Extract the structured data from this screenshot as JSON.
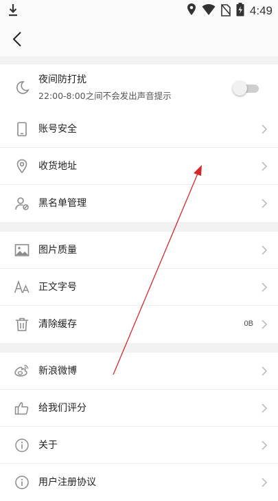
{
  "status_bar": {
    "time": "4:49"
  },
  "sections": {
    "night": {
      "title": "夜间防打扰",
      "subtitle": "22:00-8:00之间不会发出声音提示",
      "toggle_on": false
    },
    "account": [
      {
        "label": "账号安全",
        "icon": "phone-icon"
      },
      {
        "label": "收货地址",
        "icon": "location-pin-icon"
      },
      {
        "label": "黑名单管理",
        "icon": "user-block-icon"
      }
    ],
    "display": [
      {
        "label": "图片质量",
        "icon": "image-icon"
      },
      {
        "label": "正文字号",
        "icon": "font-size-icon"
      },
      {
        "label": "清除缓存",
        "icon": "trash-icon",
        "value": "0B"
      }
    ],
    "about": [
      {
        "label": "新浪微博",
        "icon": "weibo-icon"
      },
      {
        "label": "给我们评分",
        "icon": "thumbs-up-icon"
      },
      {
        "label": "关于",
        "icon": "info-icon"
      },
      {
        "label": "用户注册协议",
        "icon": "info-icon"
      }
    ]
  },
  "colors": {
    "arrow": "#d62828",
    "icon": "#8a8a8a"
  }
}
